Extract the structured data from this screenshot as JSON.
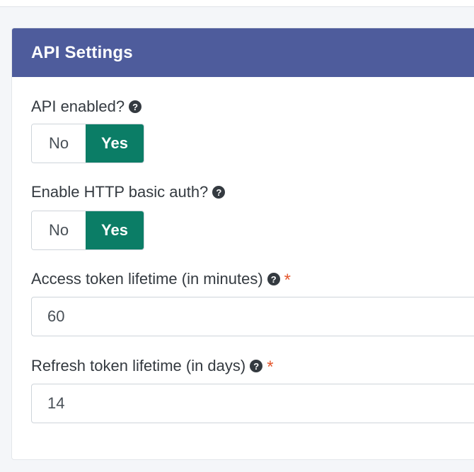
{
  "card": {
    "title": "API Settings"
  },
  "fields": [
    {
      "label": "API enabled?",
      "type": "toggle",
      "options": [
        "No",
        "Yes"
      ],
      "selected": "Yes"
    },
    {
      "label": "Enable HTTP basic auth?",
      "type": "toggle",
      "options": [
        "No",
        "Yes"
      ],
      "selected": "Yes"
    },
    {
      "label": "Access token lifetime (in minutes)",
      "type": "input",
      "required": "*",
      "value": "60"
    },
    {
      "label": "Refresh token lifetime (in days)",
      "type": "input",
      "required": "*",
      "value": "14"
    }
  ],
  "icons": {
    "help": "question-circle-icon",
    "help_glyph": "?"
  },
  "colors": {
    "header_bg": "#4e5c9c",
    "toggle_selected": "#0b7d66",
    "required": "#e4572e"
  }
}
